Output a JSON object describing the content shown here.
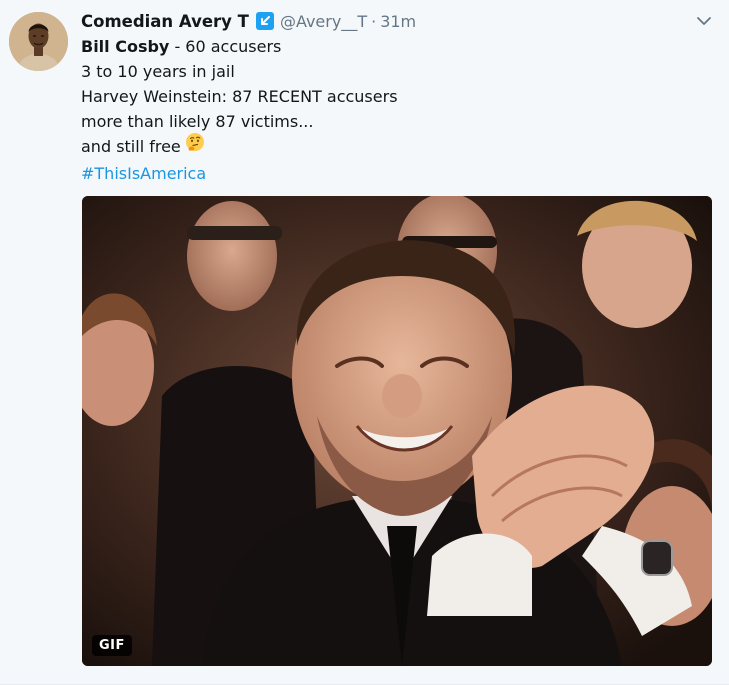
{
  "tweet": {
    "display_name": "Comedian Avery T",
    "handle": "@Avery__T",
    "separator": "·",
    "timestamp": "31m",
    "lines": {
      "l1_bold": "Bill Cosby",
      "l1_rest": " - 60 accusers",
      "l2": "3 to 10 years in jail",
      "l3": "Harvey Weinstein: 87 RECENT accusers",
      "l4": "more than likely 87 victims...",
      "l5": "and still free"
    },
    "hashtag": "#ThisIsAmerica",
    "emoji": "thinking-face",
    "media": {
      "type": "gif",
      "badge": "GIF"
    }
  },
  "icons": {
    "badge": "arrow-icon",
    "menu": "chevron-down-icon"
  },
  "colors": {
    "background": "#f5f8fa",
    "text": "#14171a",
    "muted": "#657786",
    "link": "#1b95e0",
    "badge": "#1da1f2"
  }
}
